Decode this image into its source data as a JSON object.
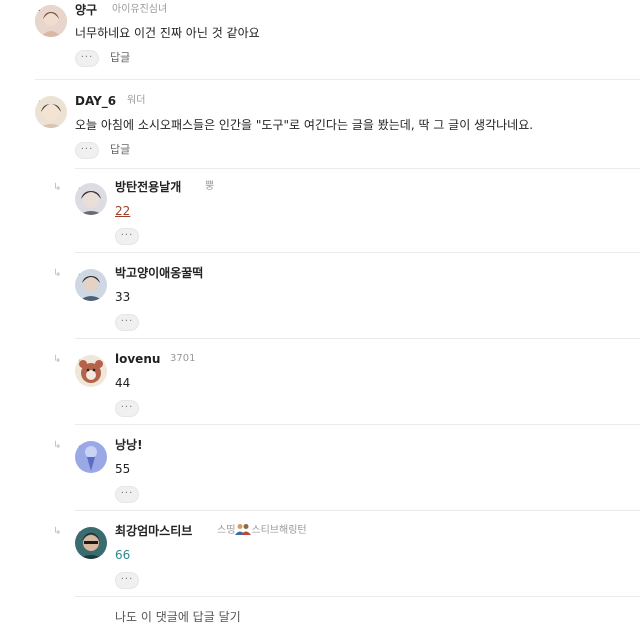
{
  "comments": [
    {
      "nickname": "양구",
      "subtitle": "아이유진심녀",
      "level": "2",
      "text": "너무하네요 이건 진짜 아닌 것 같아요",
      "more_label": "···",
      "reply_label": "답글",
      "avatar_color": "#d9c2b8"
    },
    {
      "nickname": "DAY_6",
      "subtitle": "워더",
      "level": "5",
      "text": "오늘 아침에 소시오패스들은 인간을 \"도구\"로 여긴다는 글을 봤는데, 딱 그 글이 생각나네요.",
      "more_label": "···",
      "reply_label": "답글",
      "avatar_color": "#c9b49a"
    }
  ],
  "replies": [
    {
      "nickname": "방탄전용날개",
      "subtitle": "뿡",
      "level": "5",
      "text": "22",
      "more_label": "···",
      "avatar_color": "#6b6a74"
    },
    {
      "nickname": "박고양이애옹꿀떡",
      "subtitle": "",
      "level": "5",
      "text": "33",
      "more_label": "···",
      "avatar_color": "#4a5f7a"
    },
    {
      "nickname": "lovenu",
      "subtitle": "3701",
      "level": "4",
      "text": "44",
      "more_label": "···",
      "avatar_color": "#b5624a"
    },
    {
      "nickname": "낭낭!",
      "subtitle": "",
      "level": "4",
      "text": "55",
      "more_label": "···",
      "avatar_color": "#9aa8e6"
    },
    {
      "nickname": "최강엄마스티브",
      "subtitle_left": "스띵",
      "subtitle_right": "스티브해링턴",
      "level": "5",
      "text": "66",
      "more_label": "···",
      "avatar_color": "#3a6b6e"
    }
  ],
  "write_reply": "나도 이 댓글에 답글 달기",
  "colors": {
    "reply_22": "#a0402a",
    "reply_66": "#2f8a8c",
    "divider": "#ebebeb"
  }
}
